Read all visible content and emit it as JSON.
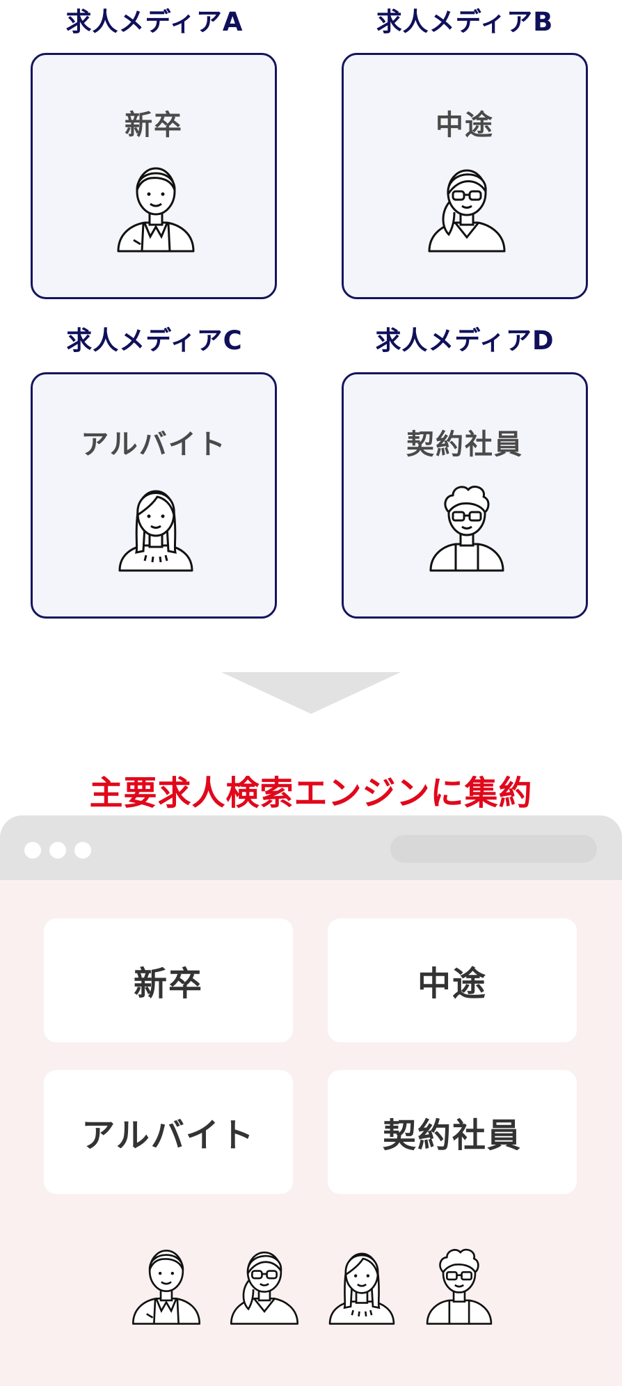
{
  "media": [
    {
      "title": "求人メディアA",
      "label": "新卒",
      "icon": "new-grad-person-icon"
    },
    {
      "title": "求人メディアB",
      "label": "中途",
      "icon": "mid-career-woman-icon"
    },
    {
      "title": "求人メディアC",
      "label": "アルバイト",
      "icon": "part-time-person-icon"
    },
    {
      "title": "求人メディアD",
      "label": "契約社員",
      "icon": "contract-employee-icon"
    }
  ],
  "arrow_icon": "down-arrow-icon",
  "engine": {
    "title": "主要求人検索エンジンに集約",
    "categories": [
      "新卒",
      "中途",
      "アルバイト",
      "契約社員"
    ]
  },
  "colors": {
    "navy": "#14145e",
    "red": "#e1081b",
    "card_bg": "#f4f5fa",
    "panel_bg": "#fbf0f0",
    "bar_gray": "#e2e2e2"
  }
}
